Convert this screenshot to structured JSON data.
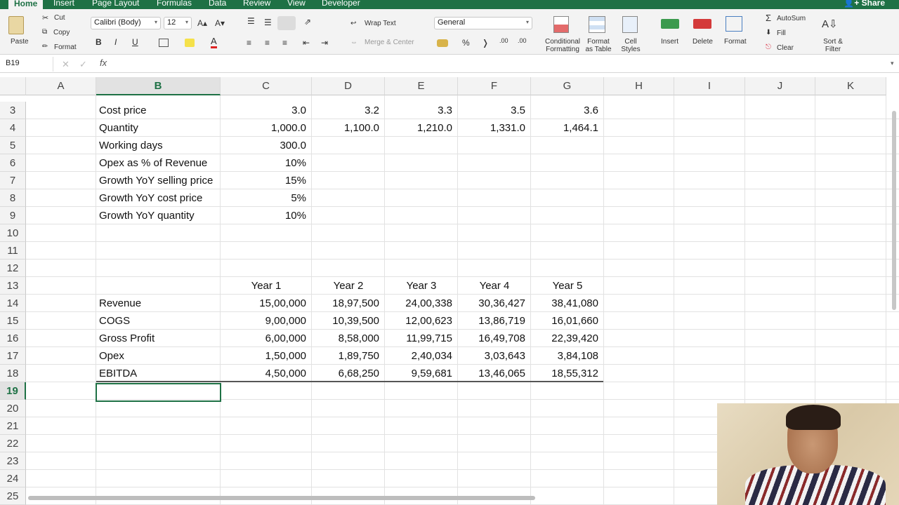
{
  "tabs": [
    "Home",
    "Insert",
    "Page Layout",
    "Formulas",
    "Data",
    "Review",
    "View",
    "Developer"
  ],
  "share_label": "Share",
  "ribbon": {
    "paste": "Paste",
    "cut": "Cut",
    "copy": "Copy",
    "format_painter": "Format",
    "font_name": "Calibri (Body)",
    "font_size": "12",
    "wrap_text": "Wrap Text",
    "merge_center": "Merge & Center",
    "number_format": "General",
    "conditional_formatting": "Conditional Formatting",
    "format_as_table": "Format as Table",
    "cell_styles": "Cell Styles",
    "insert": "Insert",
    "delete": "Delete",
    "format": "Format",
    "autosum": "AutoSum",
    "fill": "Fill",
    "clear": "Clear",
    "sort_filter": "Sort & Filter"
  },
  "formula_bar": {
    "name_box": "B19",
    "fx": "fx",
    "content": ""
  },
  "columns": [
    "A",
    "B",
    "C",
    "D",
    "E",
    "F",
    "G",
    "H",
    "I",
    "J",
    "K"
  ],
  "selected_cell": "B19",
  "rows": [
    {
      "n": "3",
      "cells": {
        "B": "Cost price",
        "C": "3.0",
        "D": "3.2",
        "E": "3.3",
        "F": "3.5",
        "G": "3.6"
      }
    },
    {
      "n": "4",
      "cells": {
        "B": "Quantity",
        "C": "1,000.0",
        "D": "1,100.0",
        "E": "1,210.0",
        "F": "1,331.0",
        "G": "1,464.1"
      }
    },
    {
      "n": "5",
      "cells": {
        "B": "Working days",
        "C": "300.0"
      }
    },
    {
      "n": "6",
      "cells": {
        "B": "Opex as % of Revenue",
        "C": "10%"
      }
    },
    {
      "n": "7",
      "cells": {
        "B": "Growth YoY selling price",
        "C": "15%"
      }
    },
    {
      "n": "8",
      "cells": {
        "B": "Growth YoY cost price",
        "C": "5%"
      }
    },
    {
      "n": "9",
      "cells": {
        "B": "Growth YoY quantity",
        "C": "10%"
      }
    },
    {
      "n": "10",
      "cells": {}
    },
    {
      "n": "11",
      "cells": {}
    },
    {
      "n": "12",
      "cells": {}
    },
    {
      "n": "13",
      "cells": {
        "C": "Year 1",
        "D": "Year 2",
        "E": "Year 3",
        "F": "Year 4",
        "G": "Year 5"
      }
    },
    {
      "n": "14",
      "cells": {
        "B": "Revenue",
        "C": "15,00,000",
        "D": "18,97,500",
        "E": "24,00,338",
        "F": "30,36,427",
        "G": "38,41,080"
      }
    },
    {
      "n": "15",
      "cells": {
        "B": "COGS",
        "C": "9,00,000",
        "D": "10,39,500",
        "E": "12,00,623",
        "F": "13,86,719",
        "G": "16,01,660"
      }
    },
    {
      "n": "16",
      "cells": {
        "B": "Gross Profit",
        "C": "6,00,000",
        "D": "8,58,000",
        "E": "11,99,715",
        "F": "16,49,708",
        "G": "22,39,420"
      }
    },
    {
      "n": "17",
      "cells": {
        "B": "Opex",
        "C": "1,50,000",
        "D": "1,89,750",
        "E": "2,40,034",
        "F": "3,03,643",
        "G": "3,84,108"
      }
    },
    {
      "n": "18",
      "cells": {
        "B": "EBITDA",
        "C": "4,50,000",
        "D": "6,68,250",
        "E": "9,59,681",
        "F": "13,46,065",
        "G": "18,55,312"
      }
    },
    {
      "n": "19",
      "cells": {}
    },
    {
      "n": "20",
      "cells": {}
    },
    {
      "n": "21",
      "cells": {}
    },
    {
      "n": "22",
      "cells": {}
    },
    {
      "n": "23",
      "cells": {}
    },
    {
      "n": "24",
      "cells": {}
    },
    {
      "n": "25",
      "cells": {}
    }
  ],
  "colors": {
    "accent": "#1e7145",
    "ribbon_bg": "#f3f3f3"
  }
}
